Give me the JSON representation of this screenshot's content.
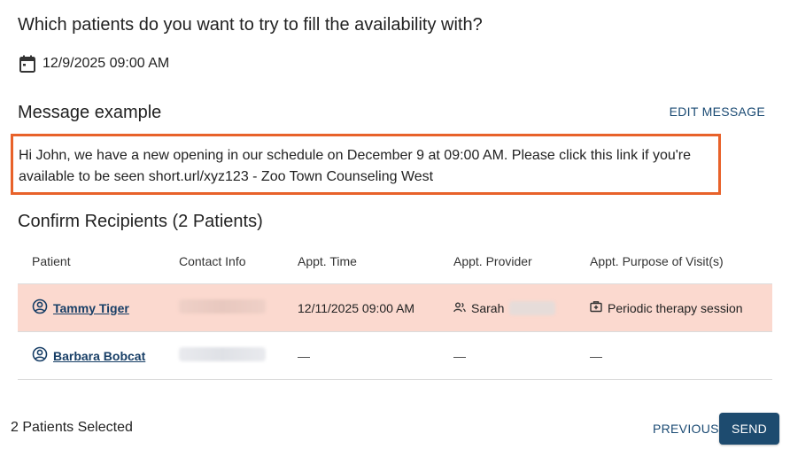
{
  "header": {
    "question": "Which patients do you want to try to fill the availability with?",
    "datetime": "12/9/2025 09:00 AM",
    "datetime_icon": "calendar-icon"
  },
  "message": {
    "title": "Message example",
    "edit_label": "EDIT MESSAGE",
    "text": "Hi John, we have a new opening in our schedule on December 9 at 09:00 AM. Please click this link if you're available to be seen short.url/xyz123 - Zoo Town Counseling West",
    "highlight_color": "#e8622a"
  },
  "recipients": {
    "title": "Confirm Recipients (2 Patients)",
    "columns": [
      "Patient",
      "Contact Info",
      "Appt. Time",
      "Appt. Provider",
      "Appt. Purpose of Visit(s)"
    ],
    "rows": [
      {
        "patient": "Tammy Tiger",
        "contact": "",
        "appt_time": "12/11/2025 09:00 AM",
        "provider": "Sarah",
        "purpose": "Periodic therapy session",
        "selected": true
      },
      {
        "patient": "Barbara Bobcat",
        "contact": "",
        "appt_time": "—",
        "provider": "—",
        "purpose": "—",
        "selected": false
      }
    ]
  },
  "footer": {
    "selected_count": "2 Patients Selected",
    "previous_label": "PREVIOUS",
    "send_label": "SEND"
  },
  "colors": {
    "selected_row": "#fbd9cf",
    "primary_button": "#1d4b6f",
    "link": "#173e66"
  }
}
